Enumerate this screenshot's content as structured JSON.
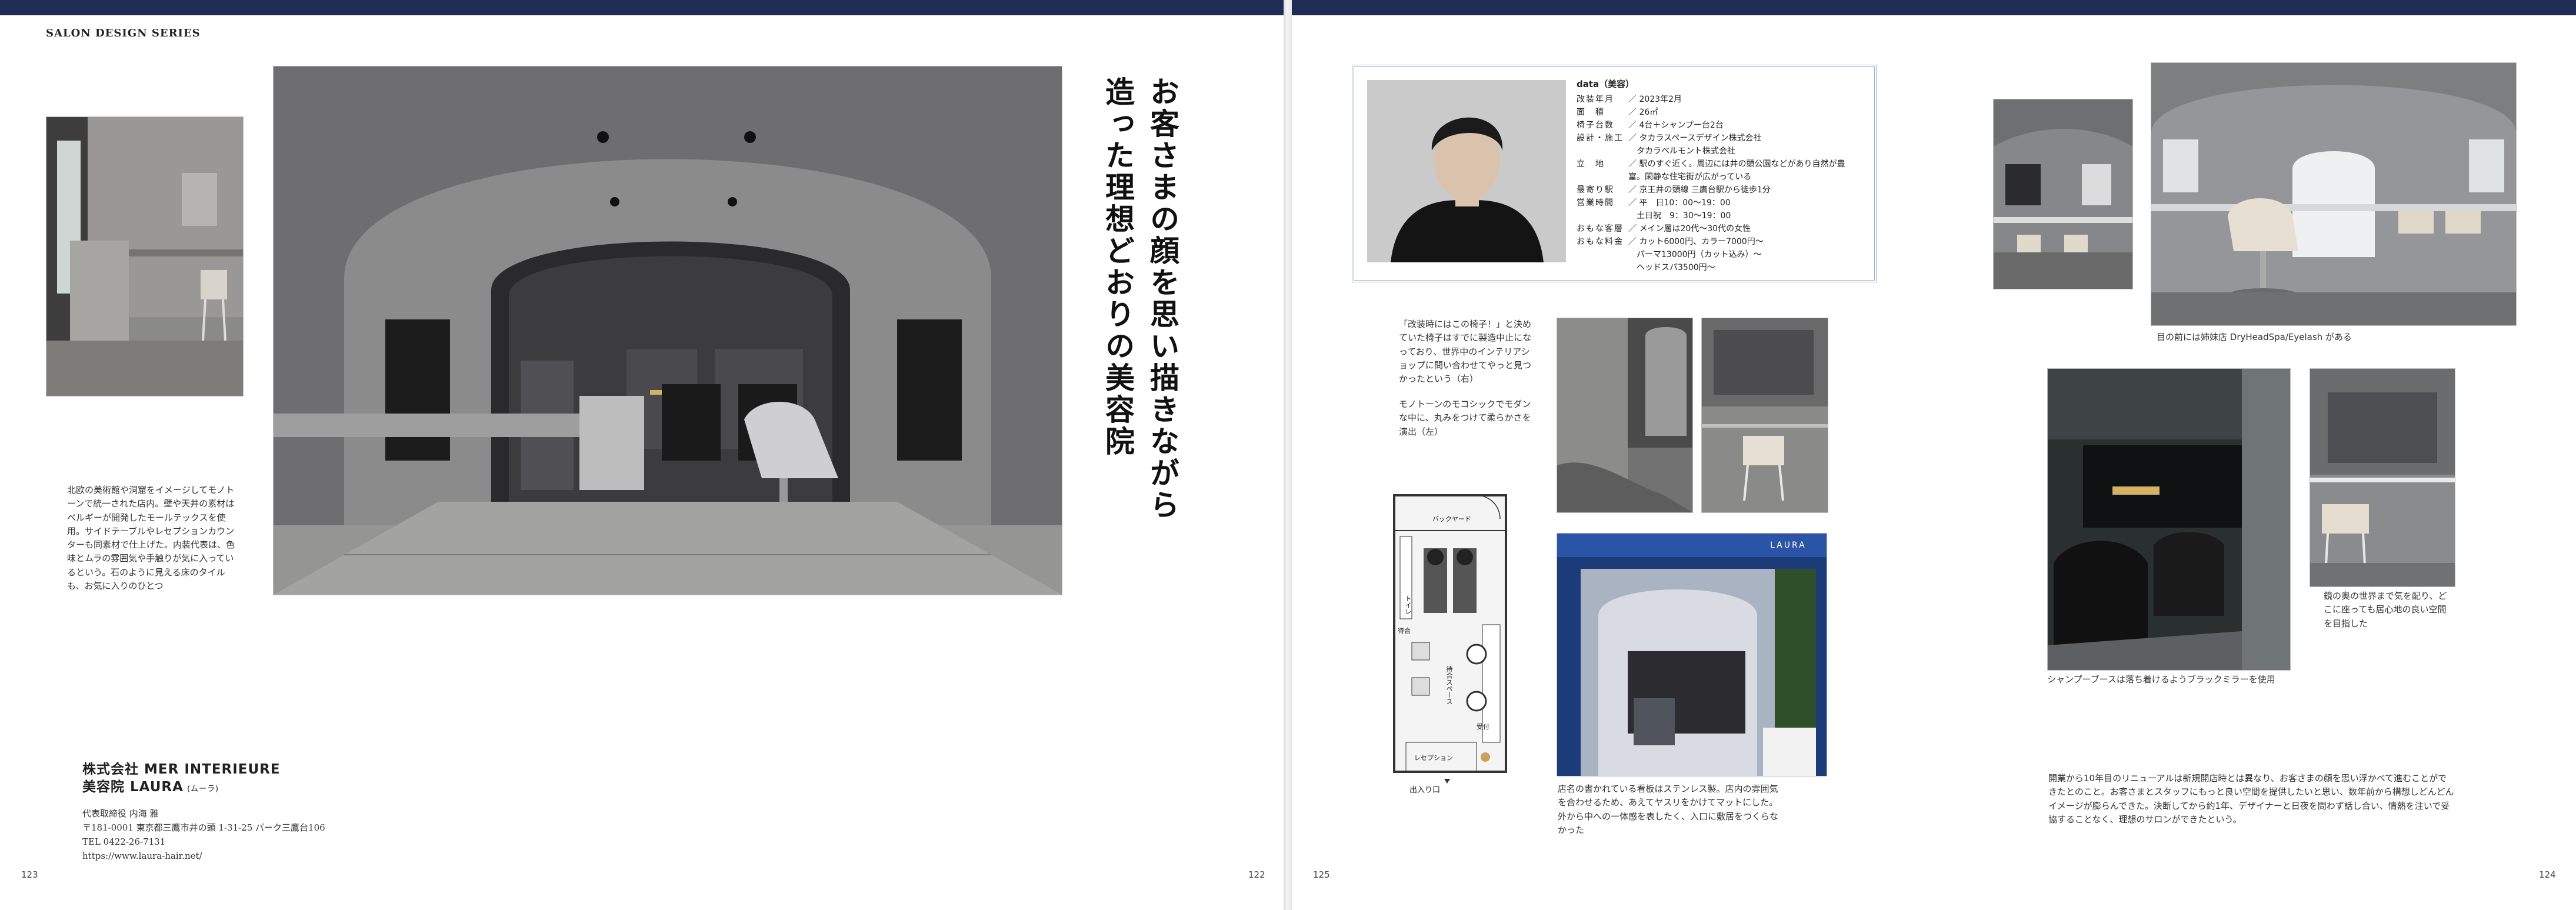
{
  "left_page": {
    "series": "SALON DESIGN SERIES",
    "headline_lines": [
      "お客さまの顔を思い描きながら",
      "造った理想どおりの美容院"
    ],
    "caption": "北欧の美術館や洞窟をイメージしてモノトーンで統一された店内。壁や天井の素材はベルギーが開発したモールテックスを使用。サイドテーブルやレセプションカウンターも同素材で仕上げた。内装代表は、色味とムラの雰囲気や手触りが気に入っているという。石のように見える床のタイルも、お気に入りのひとつ",
    "company": "株式会社 MER INTERIEURE",
    "salon": "美容院 LAURA",
    "salon_kana": "(ムーラ)",
    "rep": "代表取締役 内海 雅",
    "address": "〒181-0001 東京都三鷹市井の頭 1-31-25 パーク三鷹台106",
    "tel": "TEL 0422-26-7131",
    "url": "https://www.laura-hair.net/",
    "page_left": "123",
    "page_right": "122"
  },
  "right_page": {
    "data_title": "data（美容）",
    "data_rows": [
      {
        "k": "改装年月",
        "v": "／ 2023年2月"
      },
      {
        "k": "面　積",
        "v": "／ 26㎡"
      },
      {
        "k": "椅子台数",
        "v": "／ 4台＋シャンプー台2台"
      },
      {
        "k": "設計・施工",
        "v": "／ タカラスペースデザイン株式会社\n　タカラベルモント株式会社"
      },
      {
        "k": "立　地",
        "v": "／ 駅のすぐ近く。周辺には井の頭公園などがあり自然が豊富。閑静な住宅街が広がっている"
      },
      {
        "k": "最寄り駅",
        "v": "／ 京王井の頭線 三鷹台駅から徒歩1分"
      },
      {
        "k": "営業時間",
        "v": "／ 平　日10：00～19：00\n　土日祝　9：30～19：00"
      },
      {
        "k": "おもな客層",
        "v": "／ メイン層は20代～30代の女性"
      },
      {
        "k": "おもな料金",
        "v": "／ カット6000円、カラー7000円～\n　パーマ13000円（カット込み）～\n　ヘッドスパ3500円～"
      }
    ],
    "caption_chair": "「改装時にはこの椅子！」と決めていた椅子はすでに製造中止になっており、世界中のインテリアショップに問い合わせてやっと見つかったという（右）",
    "caption_mono": "モノトーンのモコシックでモダンな中に、丸みをつけて柔らかさを演出（左）",
    "floor_label_entrance": "出入り口",
    "floor_labels": [
      "バックヤード",
      "待合",
      "待合スペース",
      "受付",
      "レセプション",
      "トイレ"
    ],
    "caption_sign": "店名の書かれている看板はステンレス製。店内の雰囲気を合わせるため、あえてヤスリをかけてマットにした。外から中への一体感を表したく、入口に敷居をつくらなかった",
    "caption_eyelash": "目の前には姉妹店 DryHeadSpa/Eyelash がある",
    "caption_shampoo": "シャンプーブースは落ち着けるようブラックミラーを使用",
    "caption_mirror": "鏡の奥の世界まで気を配り、どこに座っても居心地の良い空間を目指した",
    "caption_story": "開業から10年目のリニューアルは新規開店時とは異なり、お客さまの顔を思い浮かべて進むことができたとのこと。お客さまとスタッフにもっと良い空間を提供したいと思い、数年前から構想しどんどんイメージが膨らんできた。決断してから約1年、デザイナーと日夜を問わず話し合い、情熱を注いで妥協することなく、理想のサロンができたという。",
    "sign_text": "LAURA",
    "page_left": "125",
    "page_right": "124"
  }
}
